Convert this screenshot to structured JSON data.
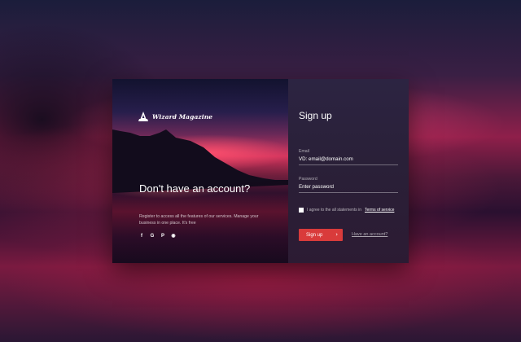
{
  "brand": {
    "name": "Wizard Magazine",
    "logo_icon": "wizard-hat-icon"
  },
  "hero": {
    "title": "Don't have an account?",
    "description": "Register to access all the features of our services. Manage your business in one place. It's free",
    "socials": [
      {
        "name": "facebook-icon",
        "glyph": "f"
      },
      {
        "name": "google-icon",
        "glyph": "G"
      },
      {
        "name": "pinterest-icon",
        "glyph": "P"
      },
      {
        "name": "github-icon",
        "glyph": "◉"
      }
    ]
  },
  "form": {
    "title": "Sign up",
    "email": {
      "label": "Email",
      "value": "VD: email@domain.com"
    },
    "password": {
      "label": "Password",
      "placeholder": "Enter password"
    },
    "agree_text": "I agree to the all statements in",
    "terms_link": "Terms of service",
    "submit_label": "Sign up",
    "submit_icon": "chevron-right-icon",
    "have_account_link": "Have an account?"
  },
  "colors": {
    "accent": "#d93b3b",
    "panel": "#2a2038"
  }
}
